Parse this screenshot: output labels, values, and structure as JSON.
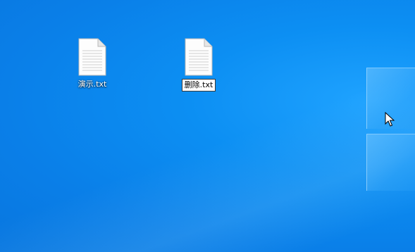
{
  "desktop": {
    "icons": [
      {
        "label": "演示.txt",
        "icon": "text-file-icon"
      },
      {
        "label": "删除.txt",
        "icon": "text-file-icon",
        "renaming": true
      }
    ]
  },
  "colors": {
    "wallpaper": "#0a7fe8",
    "label_text": "#ffffff"
  }
}
